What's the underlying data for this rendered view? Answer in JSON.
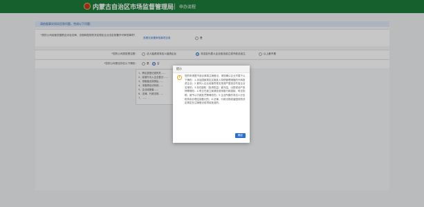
{
  "header": {
    "site_title": "内蒙古自治区市场监督管理局",
    "subtitle": "申办流程"
  },
  "info": {
    "text": "请依据事实如实回答问题，完成以下问题："
  },
  "question1": {
    "label": "*您的公司经营范围是否涉及法律、法规和国务院决定规定企业法定前置许可审批事项？",
    "link": "查看无前置审批事项目录",
    "option_yes": "是",
    "option_no": "否"
  },
  "question2": {
    "label": "*您的公司类型是否是：",
    "option_a": "法人独资或非法人独资企业",
    "option_b": "非法定代表人企业依法设立或不依法设立",
    "option_c": "以上都不是"
  },
  "question3": {
    "label": "*您的公司是否存在以下情形：",
    "option_yes": "是",
    "option_no": "否"
  },
  "list": {
    "items": [
      "1、跨区县登记或有关……",
      "2、经营行为入企业登记……",
      "3、领取营业执照后……",
      "4、未取得合法有效……",
      "5、企业经营者……",
      "6、法律、行政法规……",
      "7、……"
    ]
  },
  "modal": {
    "title": "提示",
    "body": "您的申请暂不适合简易注销登记。请您确认企业不属于以下情形：1.涉及国家规定实施准入特别管理措施的外商投资企业；2.被列入企业经营异常名录或严重违法失信企业名单的；3.存在股权（投资权益）被冻结、出质或动产抵押等情形；4.有正在被立案调查或采取行政强制、司法协助、被予以行政处罚等情形的；5.企业所属的非法人分支机构未办理注销登记的；6.法律、行政法规或者国务院决定规定在注销登记前须经批准的。",
    "ok_label": "确定"
  }
}
